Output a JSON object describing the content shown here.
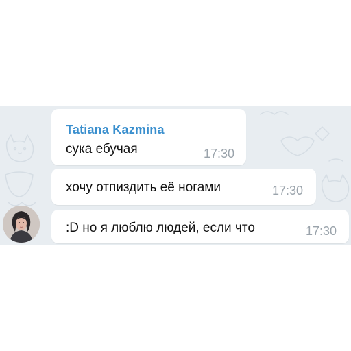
{
  "chat": {
    "sender_name": "Tatiana Kazmina",
    "messages": [
      {
        "text": "сука ебучая",
        "time": "17:30"
      },
      {
        "text": "хочу отпиздить её ногами",
        "time": "17:30"
      },
      {
        "text": ":D но я люблю людей, если что",
        "time": "17:30"
      }
    ]
  },
  "colors": {
    "chat_background": "#e8edf1",
    "bubble": "#ffffff",
    "sender_name": "#3a8fce",
    "timestamp": "#9aa3ab"
  },
  "icons": {
    "avatar": "user-avatar-photo"
  }
}
